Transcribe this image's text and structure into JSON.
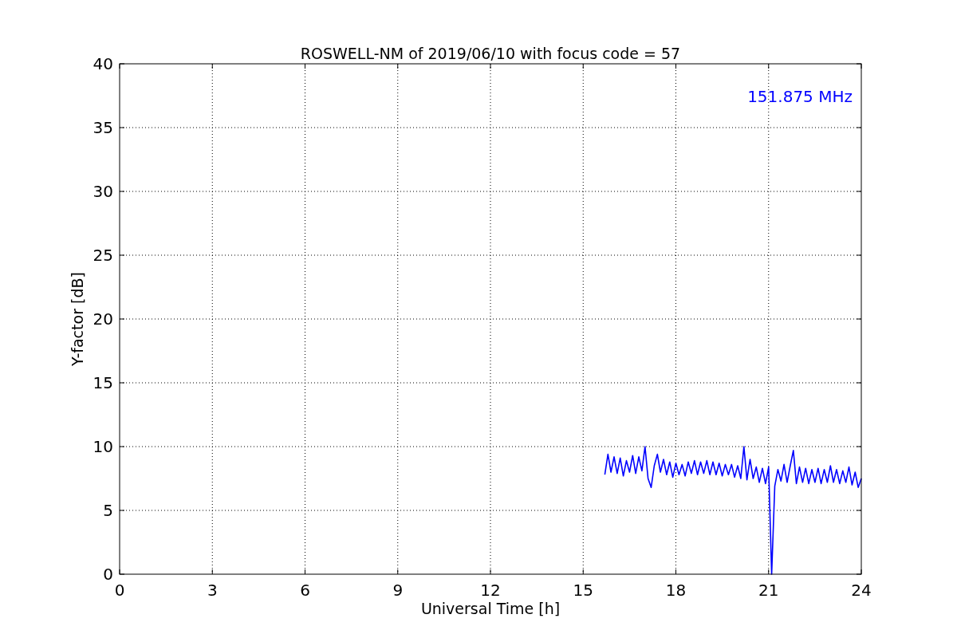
{
  "figure": {
    "chart_data": {
      "type": "line",
      "title": "ROSWELL-NM of 2019/06/10 with focus code = 57",
      "xlabel": "Universal Time [h]",
      "ylabel": "Y-factor [dB]",
      "xlim": [
        0,
        24
      ],
      "ylim": [
        0,
        40
      ],
      "grid": true,
      "xticks": [
        0,
        3,
        6,
        9,
        12,
        15,
        18,
        21,
        24
      ],
      "yticks": [
        0,
        5,
        10,
        15,
        20,
        25,
        30,
        35,
        40
      ],
      "x": [
        15.7,
        15.8,
        15.9,
        16.0,
        16.1,
        16.2,
        16.3,
        16.4,
        16.5,
        16.6,
        16.7,
        16.8,
        16.9,
        17.0,
        17.1,
        17.2,
        17.3,
        17.4,
        17.5,
        17.6,
        17.7,
        17.8,
        17.9,
        18.0,
        18.1,
        18.2,
        18.3,
        18.4,
        18.5,
        18.6,
        18.7,
        18.8,
        18.9,
        19.0,
        19.1,
        19.2,
        19.3,
        19.4,
        19.5,
        19.6,
        19.7,
        19.8,
        19.9,
        20.0,
        20.1,
        20.2,
        20.3,
        20.4,
        20.5,
        20.6,
        20.7,
        20.8,
        20.9,
        21.0,
        21.1,
        21.2,
        21.3,
        21.4,
        21.5,
        21.6,
        21.7,
        21.8,
        21.9,
        22.0,
        22.1,
        22.2,
        22.3,
        22.4,
        22.5,
        22.6,
        22.7,
        22.8,
        22.9,
        23.0,
        23.1,
        23.2,
        23.3,
        23.4,
        23.5,
        23.6,
        23.7,
        23.8,
        23.9,
        24.0
      ],
      "series": [
        {
          "name": "151.875 MHz",
          "color": "#0000ff",
          "values": [
            7.8,
            9.4,
            8.0,
            9.2,
            7.9,
            9.1,
            7.7,
            8.9,
            8.0,
            9.3,
            7.9,
            9.2,
            8.1,
            10.0,
            7.5,
            6.8,
            8.5,
            9.4,
            8.0,
            9.0,
            7.8,
            8.8,
            7.6,
            8.7,
            7.8,
            8.6,
            7.7,
            8.8,
            7.9,
            8.9,
            7.8,
            8.8,
            7.9,
            8.9,
            7.8,
            8.8,
            7.8,
            8.7,
            7.7,
            8.6,
            7.8,
            8.6,
            7.6,
            8.5,
            7.5,
            10.0,
            7.4,
            9.0,
            7.5,
            8.4,
            7.2,
            8.3,
            7.1,
            8.4,
            0,
            6.9,
            8.2,
            7.3,
            8.6,
            7.2,
            8.5,
            9.7,
            7.1,
            8.4,
            7.2,
            8.3,
            7.1,
            8.2,
            7.2,
            8.3,
            7.1,
            8.2,
            7.2,
            8.5,
            7.2,
            8.2,
            7.1,
            8.1,
            7.2,
            8.4,
            7.0,
            8.0,
            6.8,
            7.5
          ]
        }
      ]
    }
  }
}
